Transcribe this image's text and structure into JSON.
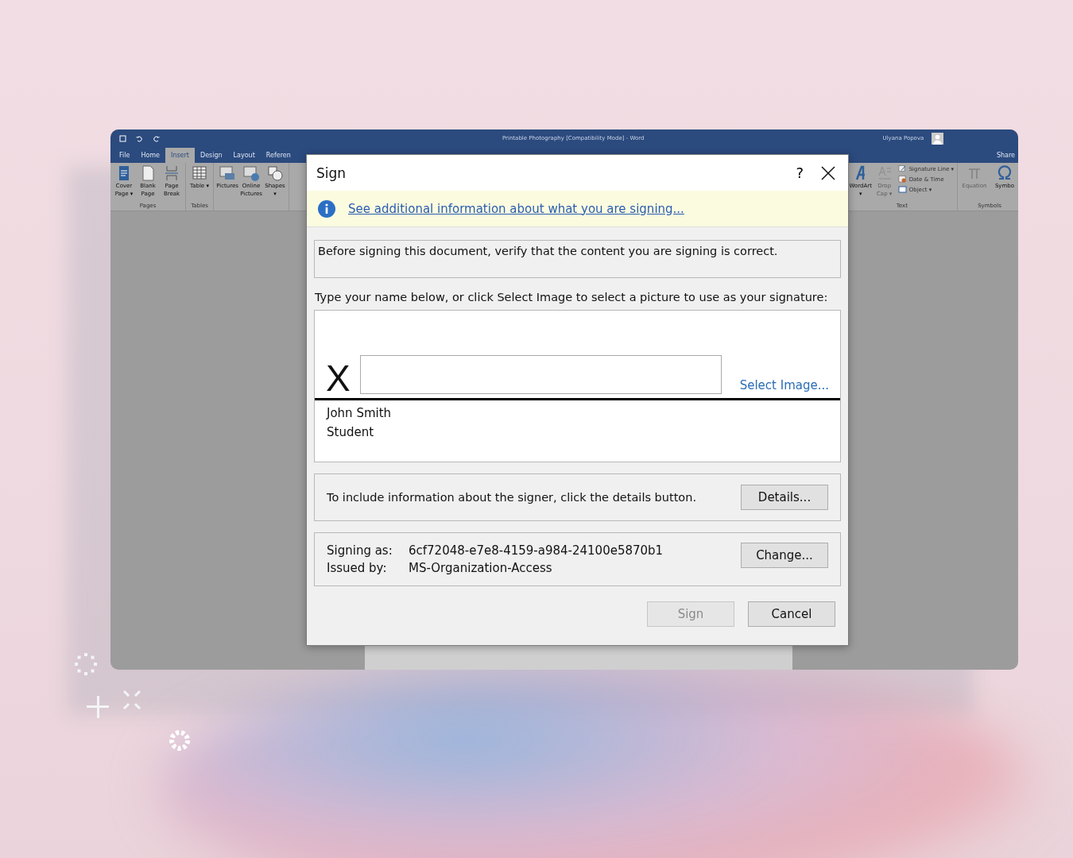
{
  "word_window": {
    "title": "Printable Photography [Compatibility Mode]  -  Word",
    "user": "Ulyana Popova",
    "share": "Share",
    "tabs": [
      {
        "label": "File",
        "selected": false
      },
      {
        "label": "Home",
        "selected": false
      },
      {
        "label": "Insert",
        "selected": true
      },
      {
        "label": "Design",
        "selected": false
      },
      {
        "label": "Layout",
        "selected": false
      },
      {
        "label": "Referen",
        "selected": false
      }
    ],
    "left_groups": [
      {
        "name": "Pages",
        "buttons": [
          {
            "label": "Cover Page ▾",
            "disabled": false
          },
          {
            "label": "Blank Page",
            "disabled": false
          },
          {
            "label": "Page Break",
            "disabled": false
          }
        ]
      },
      {
        "name": "Tables",
        "buttons": [
          {
            "label": "Table ▾",
            "disabled": false
          }
        ]
      },
      {
        "buttons": [
          {
            "label": "Pictures",
            "disabled": false
          },
          {
            "label": "Online Pictures",
            "disabled": false
          },
          {
            "label": "Shapes ▾",
            "disabled": false
          }
        ]
      }
    ],
    "text_group": {
      "name": "Text",
      "buttons": [
        {
          "label": "WordArt ▾",
          "disabled": false
        },
        {
          "label": "Drop Cap ▾",
          "disabled": true
        }
      ],
      "small_buttons": [
        {
          "label": "Signature Line ▾"
        },
        {
          "label": "Date & Time"
        },
        {
          "label": "Object ▾"
        }
      ]
    },
    "symbols_group": {
      "name": "Symbols",
      "buttons": [
        {
          "label": "Equation",
          "disabled": true
        },
        {
          "label": "Symbo",
          "disabled": false
        }
      ]
    }
  },
  "dialog": {
    "title": "Sign",
    "help": "?",
    "info_link": "See additional information about what you are signing...",
    "verify_message": "Before signing this document, verify that the content you are signing is correct.",
    "instruction": "Type your name below, or click Select Image to select a picture to use as your signature:",
    "signature_mark": "X",
    "select_image": "Select Image...",
    "signer_name": "John Smith",
    "signer_title": "Student",
    "details_text": "To include information about the signer, click the details button.",
    "details_button": "Details...",
    "signing_as_label": "Signing as:",
    "signing_as_value": "6cf72048-e7e8-4159-a984-24100e5870b1",
    "issued_by_label": "Issued by:",
    "issued_by_value": "MS-Organization-Access",
    "change_button": "Change...",
    "buttons": [
      {
        "label": "Sign",
        "disabled": true
      },
      {
        "label": "Cancel",
        "disabled": false
      }
    ]
  }
}
